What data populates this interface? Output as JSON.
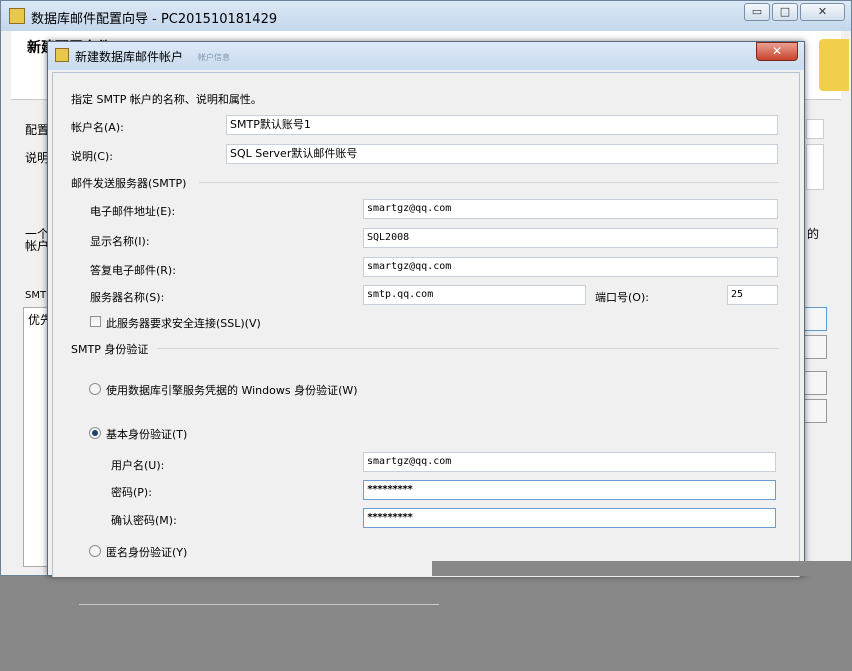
{
  "parent_window": {
    "title": "数据库邮件配置向导 - PC201510181429",
    "header_fragment": "新建配置文件",
    "label_profile": "配置",
    "label_desc": "说明",
    "text_fragment_1": "一个",
    "text_fragment_2": "帐户",
    "text_fragment_3": "的",
    "smtp_fragment": "SMTP",
    "list_fragment": "优先",
    "min_glyph": "▭",
    "max_glyph": "□",
    "close_glyph": "✕"
  },
  "dialog": {
    "title": "新建数据库邮件帐户",
    "ghost_text": "帐户信息",
    "close_glyph": "✕",
    "intro": "指定 SMTP 帐户的名称、说明和属性。",
    "account_name_label": "帐户名(A):",
    "account_name_value": "SMTP默认账号1",
    "description_label": "说明(C):",
    "description_value": "SQL Server默认邮件账号",
    "smtp_group": "邮件发送服务器(SMTP)",
    "email_label": "电子邮件地址(E):",
    "email_value": "smartgz@qq.com",
    "display_label": "显示名称(I):",
    "display_value": "SQL2008",
    "reply_label": "答复电子邮件(R):",
    "reply_value": "smartgz@qq.com",
    "server_label": "服务器名称(S):",
    "server_value": "smtp.qq.com",
    "port_label": "端口号(O):",
    "port_value": "25",
    "ssl_label": "此服务器要求安全连接(SSL)(V)",
    "auth_group": "SMTP 身份验证",
    "windows_auth_label": "使用数据库引擎服务凭据的 Windows 身份验证(W)",
    "basic_auth_label": "基本身份验证(T)",
    "username_label": "用户名(U):",
    "username_value": "smartgz@qq.com",
    "password_label": "密码(P):",
    "password_value": "*********",
    "confirm_label": "确认密码(M):",
    "confirm_value": "*********",
    "anonymous_label": "匿名身份验证(Y)"
  },
  "colors": {
    "accent": "#1f3f6d",
    "close": "#c8442c"
  }
}
